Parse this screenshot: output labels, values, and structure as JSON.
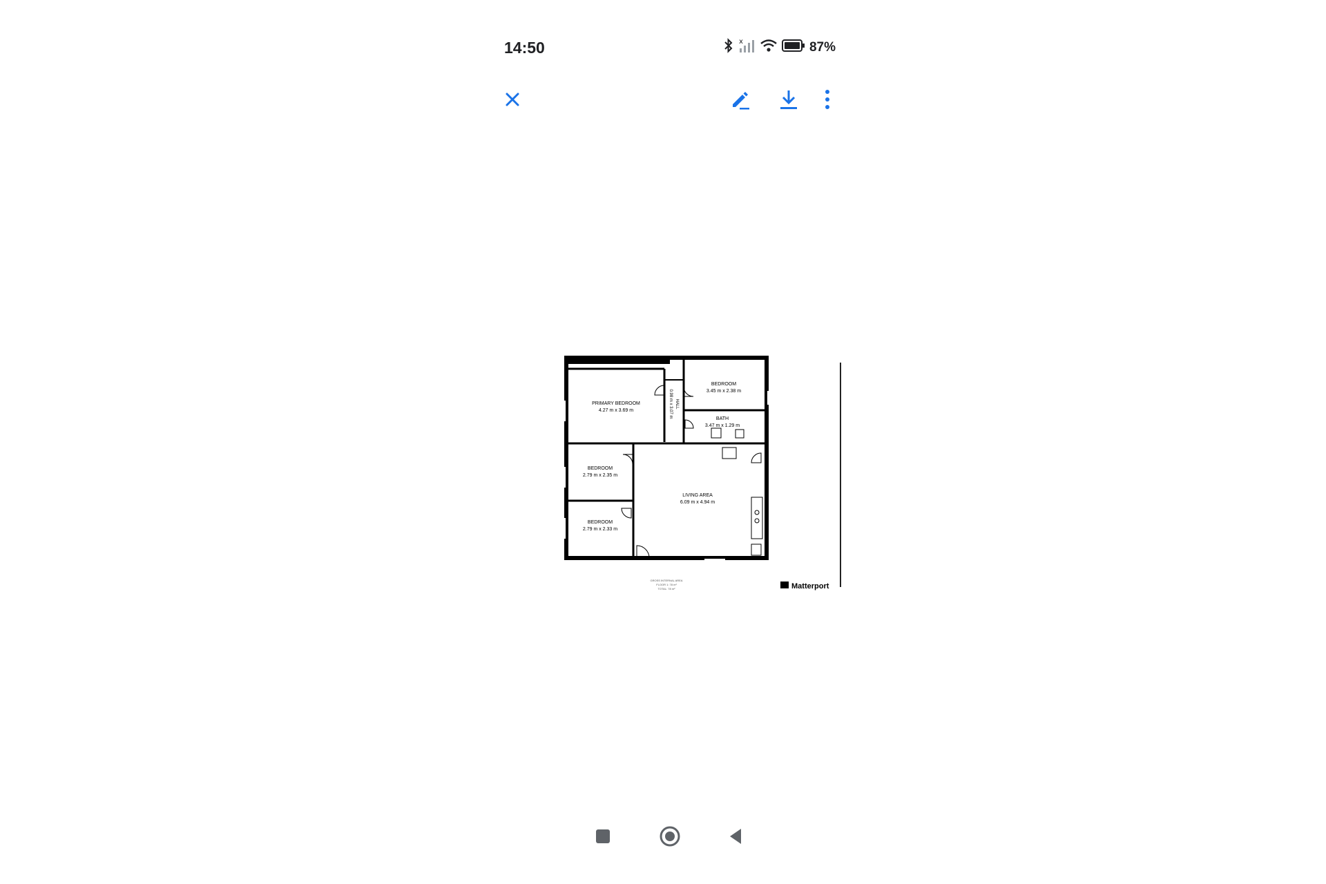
{
  "status_bar": {
    "time": "14:50",
    "battery_percent": "87%",
    "icons": [
      "bluetooth-icon",
      "signal-off-icon",
      "wifi-icon",
      "battery-icon"
    ]
  },
  "app_bar": {
    "actions": [
      "close-icon",
      "edit-icon",
      "download-icon",
      "more-vert-icon"
    ],
    "accent_color": "#1a73e8"
  },
  "floor_plan": {
    "rooms": [
      {
        "name": "PRIMARY BEDROOM",
        "size": "4.27 m x 3.69 m"
      },
      {
        "name": "BEDROOM",
        "size": "3.45 m x 2.38 m"
      },
      {
        "name": "HALL",
        "size": "0.98 m x 3.07 m"
      },
      {
        "name": "BATH",
        "size": "3.47 m x 1.29 m"
      },
      {
        "name": "BEDROOM",
        "size": "2.79 m x 2.35 m"
      },
      {
        "name": "LIVING AREA",
        "size": "6.09 m x 4.94 m"
      },
      {
        "name": "BEDROOM",
        "size": "2.79 m x 2.33 m"
      }
    ],
    "area_note": {
      "title": "GROSS INTERNAL AREA",
      "floor": "FLOOR 1: 78 m²",
      "total": "TOTAL: 78 m²"
    },
    "brand": "Matterport"
  },
  "nav_bar": {
    "buttons": [
      "recents-button",
      "home-button",
      "back-button"
    ]
  }
}
